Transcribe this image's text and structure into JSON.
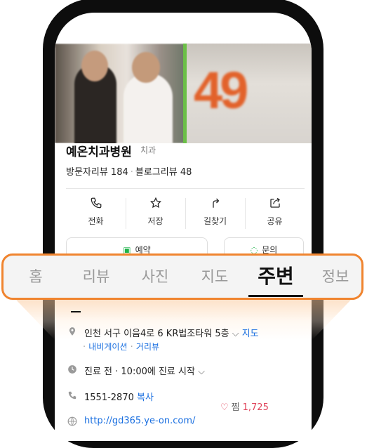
{
  "place": {
    "name": "예온치과병원",
    "category": "치과",
    "visitor_reviews": "방문자리뷰 184",
    "blog_reviews": "블로그리뷰 48"
  },
  "actions": [
    {
      "label": "전화",
      "icon": "phone-icon"
    },
    {
      "label": "저장",
      "icon": "star-icon"
    },
    {
      "label": "길찾기",
      "icon": "directions-icon"
    },
    {
      "label": "공유",
      "icon": "share-icon"
    }
  ],
  "peek_buttons": {
    "reserve": "예약",
    "inquiry": "문의"
  },
  "tabs": [
    {
      "label": "홈"
    },
    {
      "label": "리뷰"
    },
    {
      "label": "사진"
    },
    {
      "label": "지도"
    },
    {
      "label": "주변"
    },
    {
      "label": "정보"
    }
  ],
  "active_tab": "주변",
  "details": {
    "address": "인천 서구 이음4로 6 KR법조타워 5층",
    "map_link": "지도",
    "navigation": "내비게이션",
    "distance_view": "거리뷰",
    "hours": "진료 전 · 10:00에 진료 시작",
    "phone": "1551-2870",
    "copy": "복사",
    "website": "http://gd365.ye-on.com/",
    "likes_label": "찜",
    "likes_count": "1,725"
  },
  "colors": {
    "accent_orange": "#f0842f",
    "link_blue": "#1a6fe0",
    "heart_red": "#e0455c"
  }
}
